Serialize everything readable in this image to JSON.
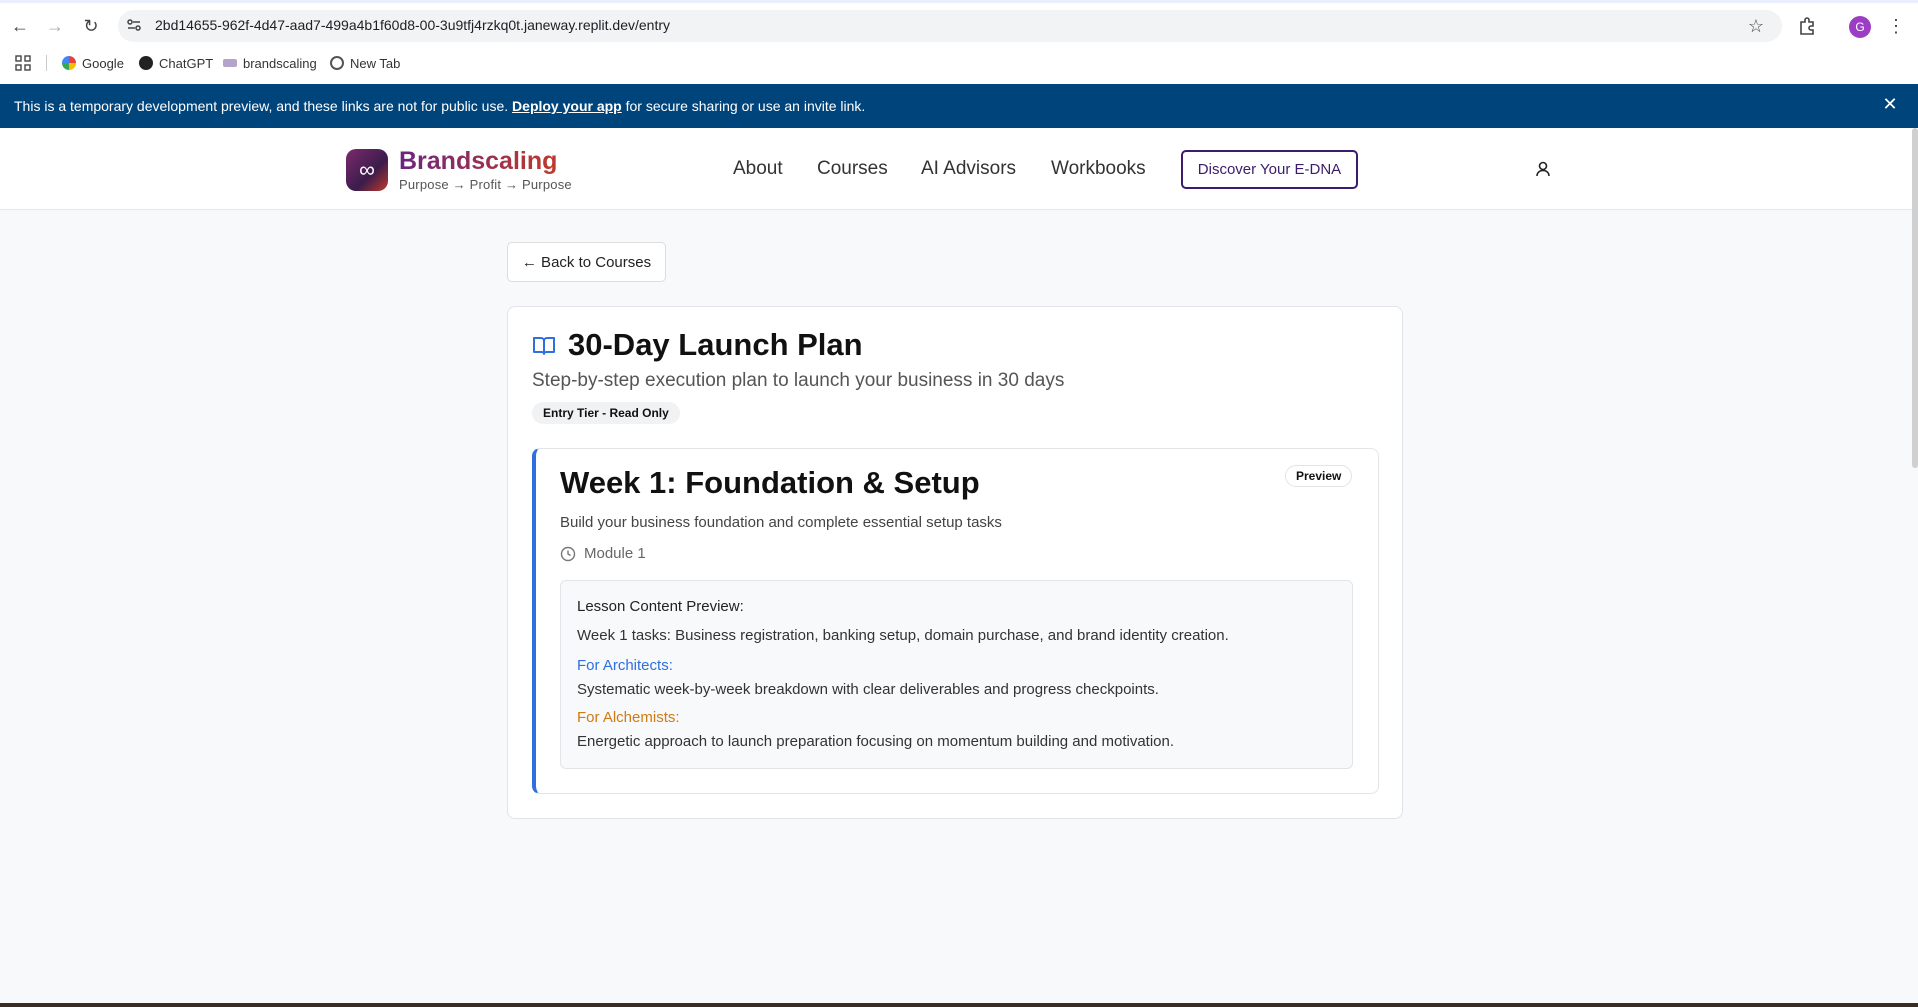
{
  "browser": {
    "url": "2bd14655-962f-4d47-aad7-499a4b1f60d8-00-3u9tfj4rzkq0t.janeway.replit.dev/entry",
    "avatar_letter": "G",
    "bookmarks": [
      {
        "label": "Google",
        "icon": "google-icon"
      },
      {
        "label": "ChatGPT",
        "icon": "chatgpt-icon"
      },
      {
        "label": "brandscaling",
        "icon": "brandscaling-icon"
      },
      {
        "label": "New Tab",
        "icon": "globe-icon"
      }
    ]
  },
  "dev_banner": {
    "text_before": "This is a temporary development preview, and these links are not for public use. ",
    "link": "Deploy your app",
    "text_after": " for secure sharing or use an invite link.",
    "close": "✕"
  },
  "header": {
    "logo_glyph": "∞",
    "brand": "Brandscaling",
    "tagline": "Purpose → Profit → Purpose",
    "nav": [
      "About",
      "Courses",
      "AI Advisors",
      "Workbooks"
    ],
    "cta": "Discover Your E-DNA"
  },
  "page": {
    "back_label": "← Back to Courses",
    "course_title": "30-Day Launch Plan",
    "course_desc": "Step-by-step execution plan to launch your business in 30 days",
    "tier_badge": "Entry Tier - Read Only",
    "module": {
      "title": "Week 1: Foundation & Setup",
      "badge": "Preview",
      "desc": "Build your business foundation and complete essential setup tasks",
      "number": "Module 1",
      "lesson": {
        "heading": "Lesson Content Preview:",
        "summary": "Week 1 tasks: Business registration, banking setup, domain purchase, and brand identity creation.",
        "architects_label": "For Architects:",
        "architects_text": "Systematic week-by-week breakdown with clear deliverables and progress checkpoints.",
        "alchemists_label": "For Alchemists:",
        "alchemists_text": "Energetic approach to launch preparation focusing on momentum building and motivation."
      }
    }
  },
  "colors": {
    "banner": "#00447c",
    "accent_blue": "#2f6fe0",
    "accent_orange": "#d07a12",
    "brand_purple": "#3b1c6a"
  }
}
